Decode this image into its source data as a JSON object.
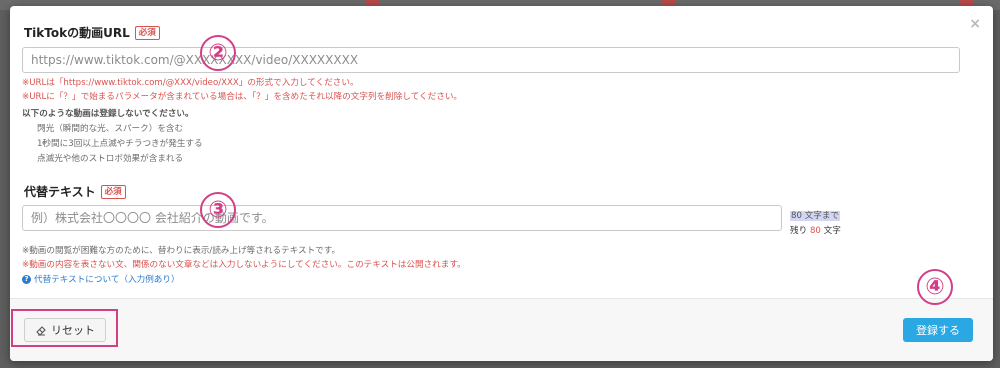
{
  "modal": {
    "close_label": "×"
  },
  "url_section": {
    "label": "TikTokの動画URL",
    "required": "必須",
    "placeholder": "https://www.tiktok.com/@XXXXXXXX/video/XXXXXXXX",
    "note_1": "※URLは「https://www.tiktok.com/@XXX/video/XXX」の形式で入力してください。",
    "note_2": "※URLに「？」で始まるパラメータが含まれている場合は、「？」を含めたそれ以降の文字列を削除してください。",
    "warning_heading": "以下のような動画は登録しないでください。",
    "warnings": [
      "閃光（瞬間的な光、スパーク）を含む",
      "1秒間に3回以上点滅やチラつきが発生する",
      "点滅光や他のストロボ効果が含まれる"
    ]
  },
  "alt_section": {
    "label": "代替テキスト",
    "required": "必須",
    "placeholder": "例）株式会社〇〇〇〇 会社紹介の動画です。",
    "counter_max": "80 文字まで",
    "counter_remaining_prefix": "残り",
    "counter_remaining_value": "80",
    "counter_remaining_suffix": "文字",
    "note_1": "※動画の閲覧が困難な方のために、替わりに表示/読み上げ等されるテキストです。",
    "note_2": "※動画の内容を表さない文、関係のない文章などは入力しないようにしてください。このテキストは公開されます。",
    "help_link": "代替テキストについて（入力例あり）"
  },
  "footer": {
    "reset_label": "リセット",
    "submit_label": "登録する"
  },
  "markers": [
    "②",
    "③",
    "④"
  ],
  "colors": {
    "accent": "#2aa8e4",
    "required": "#d9534f",
    "annotation": "#d23f86"
  }
}
